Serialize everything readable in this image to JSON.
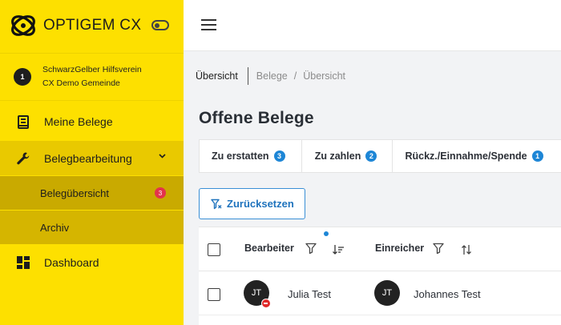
{
  "brand": {
    "name": "OPTIGEM CX",
    "logo_icon": "optigem-logo-icon"
  },
  "organization": {
    "badge": "1",
    "line1": "SchwarzGelber Hilfsverein",
    "line2": "CX Demo Gemeinde"
  },
  "sidebar": {
    "items": [
      {
        "label": "Meine Belege",
        "icon": "receipt-icon"
      },
      {
        "label": "Belegbearbeitung",
        "icon": "wrench-icon",
        "expanded": true
      },
      {
        "label": "Belegübersicht",
        "badge": "3",
        "active": true
      },
      {
        "label": "Archiv"
      },
      {
        "label": "Dashboard",
        "icon": "dashboard-icon"
      }
    ]
  },
  "breadcrumb": {
    "current": "Übersicht",
    "parent": "Belege",
    "slash": "/",
    "leaf": "Übersicht"
  },
  "page": {
    "title": "Offene Belege"
  },
  "tabs": [
    {
      "label": "Zu erstatten",
      "count": "3"
    },
    {
      "label": "Zu zahlen",
      "count": "2"
    },
    {
      "label": "Rückz./Einnahme/Spende",
      "count": "1"
    }
  ],
  "reset_button": {
    "label": "Zurücksetzen"
  },
  "table": {
    "columns": [
      "Bearbeiter",
      "Einreicher"
    ],
    "rows": [
      {
        "bearbeiter_initials": "JT",
        "bearbeiter": "Julia Test",
        "einreicher_initials": "JT",
        "einreicher": "Johannes Test"
      }
    ]
  },
  "colors": {
    "sidebar": "#fde000",
    "accent": "#1d86d6",
    "badge_red": "#e3344b"
  }
}
